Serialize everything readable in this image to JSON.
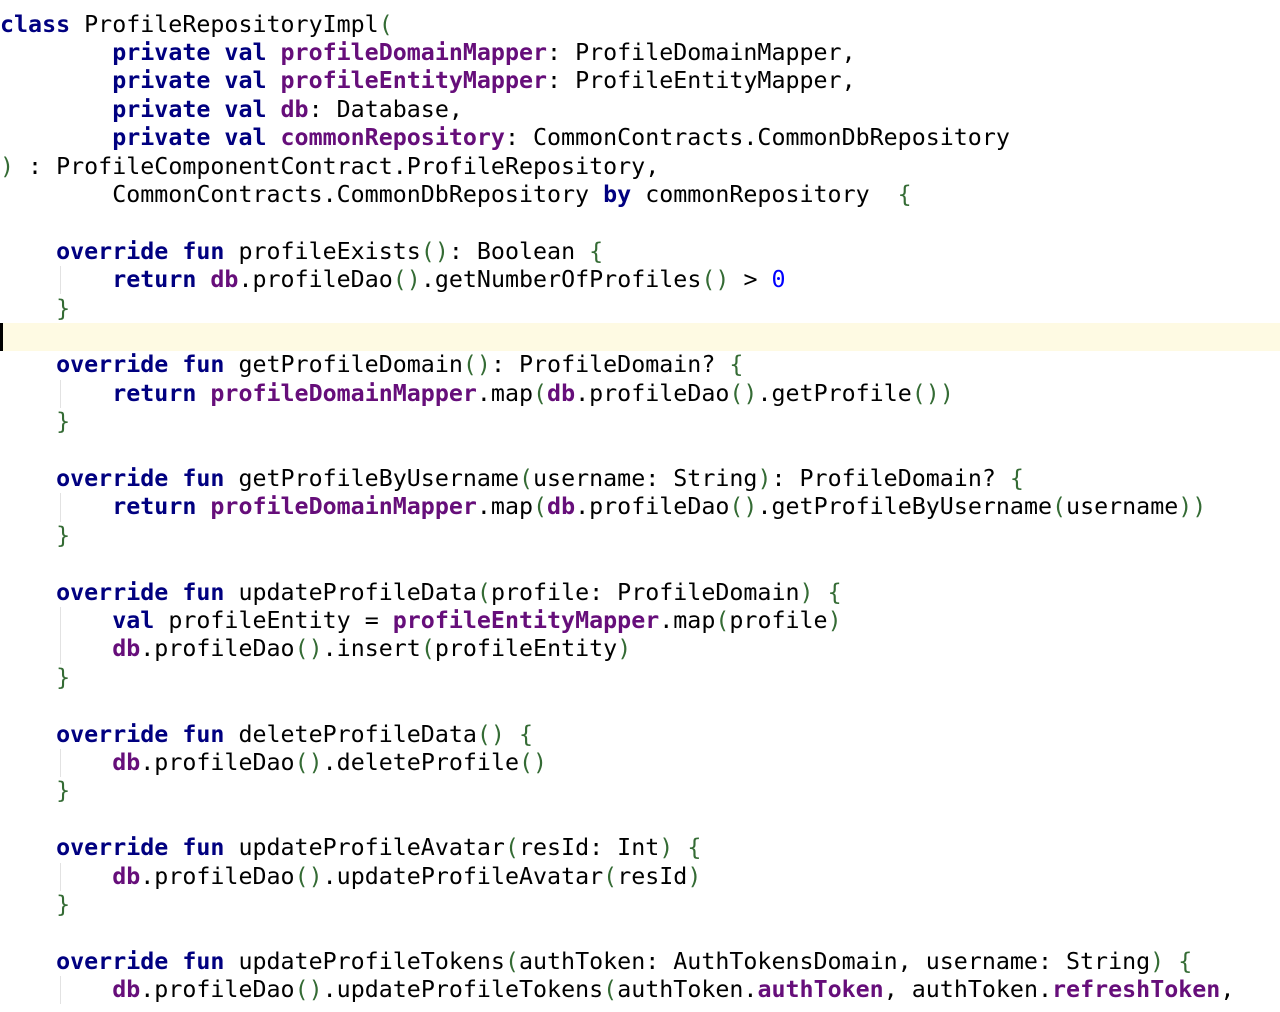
{
  "colors": {
    "keyword": "#000080",
    "field": "#660e7a",
    "number": "#0000ff",
    "bracket": "#346b34",
    "plain": "#000000",
    "current_line": "#fefae3"
  },
  "editor": {
    "current_line_index": 11,
    "lines": [
      [
        {
          "t": "class ",
          "c": "kw"
        },
        {
          "t": "ProfileRepositoryImpl"
        },
        {
          "t": "(",
          "c": "br"
        }
      ],
      [
        {
          "t": "        "
        },
        {
          "t": "private val ",
          "c": "kw"
        },
        {
          "t": "profileDomainMapper",
          "c": "fb"
        },
        {
          "t": ": ProfileDomainMapper,"
        }
      ],
      [
        {
          "t": "        "
        },
        {
          "t": "private val ",
          "c": "kw"
        },
        {
          "t": "profileEntityMapper",
          "c": "fb"
        },
        {
          "t": ": ProfileEntityMapper,"
        }
      ],
      [
        {
          "t": "        "
        },
        {
          "t": "private val ",
          "c": "kw"
        },
        {
          "t": "db",
          "c": "fb"
        },
        {
          "t": ": Database,"
        }
      ],
      [
        {
          "t": "        "
        },
        {
          "t": "private val ",
          "c": "kw"
        },
        {
          "t": "commonRepository",
          "c": "fb"
        },
        {
          "t": ": CommonContracts.CommonDbRepository"
        }
      ],
      [
        {
          "t": ")",
          "c": "br"
        },
        {
          "t": " : ProfileComponentContract.ProfileRepository,"
        }
      ],
      [
        {
          "t": "        CommonContracts.CommonDbRepository "
        },
        {
          "t": "by ",
          "c": "kw"
        },
        {
          "t": "commonRepository  "
        },
        {
          "t": "{",
          "c": "br"
        }
      ],
      [],
      [
        {
          "t": "    "
        },
        {
          "t": "override fun ",
          "c": "kw"
        },
        {
          "t": "profileExists"
        },
        {
          "t": "()",
          "c": "br"
        },
        {
          "t": ": Boolean "
        },
        {
          "t": "{",
          "c": "br"
        }
      ],
      [
        {
          "t": "        "
        },
        {
          "t": "return ",
          "c": "kw"
        },
        {
          "t": "db",
          "c": "fb"
        },
        {
          "t": ".profileDao"
        },
        {
          "t": "()",
          "c": "br"
        },
        {
          "t": ".getNumberOfProfiles"
        },
        {
          "t": "()",
          "c": "br"
        },
        {
          "t": " > "
        },
        {
          "t": "0",
          "c": "num"
        }
      ],
      [
        {
          "t": "    "
        },
        {
          "t": "}",
          "c": "br"
        }
      ],
      [],
      [
        {
          "t": "    "
        },
        {
          "t": "override fun ",
          "c": "kw"
        },
        {
          "t": "getProfileDomain"
        },
        {
          "t": "()",
          "c": "br"
        },
        {
          "t": ": ProfileDomain? "
        },
        {
          "t": "{",
          "c": "br"
        }
      ],
      [
        {
          "t": "        "
        },
        {
          "t": "return ",
          "c": "kw"
        },
        {
          "t": "profileDomainMapper",
          "c": "fb"
        },
        {
          "t": ".map"
        },
        {
          "t": "(",
          "c": "br"
        },
        {
          "t": "db",
          "c": "fb"
        },
        {
          "t": ".profileDao"
        },
        {
          "t": "()",
          "c": "br"
        },
        {
          "t": ".getProfile"
        },
        {
          "t": "())",
          "c": "br"
        }
      ],
      [
        {
          "t": "    "
        },
        {
          "t": "}",
          "c": "br"
        }
      ],
      [],
      [
        {
          "t": "    "
        },
        {
          "t": "override fun ",
          "c": "kw"
        },
        {
          "t": "getProfileByUsername"
        },
        {
          "t": "(",
          "c": "br"
        },
        {
          "t": "username: String"
        },
        {
          "t": ")",
          "c": "br"
        },
        {
          "t": ": ProfileDomain? "
        },
        {
          "t": "{",
          "c": "br"
        }
      ],
      [
        {
          "t": "        "
        },
        {
          "t": "return ",
          "c": "kw"
        },
        {
          "t": "profileDomainMapper",
          "c": "fb"
        },
        {
          "t": ".map"
        },
        {
          "t": "(",
          "c": "br"
        },
        {
          "t": "db",
          "c": "fb"
        },
        {
          "t": ".profileDao"
        },
        {
          "t": "()",
          "c": "br"
        },
        {
          "t": ".getProfileByUsername"
        },
        {
          "t": "(",
          "c": "br"
        },
        {
          "t": "username"
        },
        {
          "t": "))",
          "c": "br"
        }
      ],
      [
        {
          "t": "    "
        },
        {
          "t": "}",
          "c": "br"
        }
      ],
      [],
      [
        {
          "t": "    "
        },
        {
          "t": "override fun ",
          "c": "kw"
        },
        {
          "t": "updateProfileData"
        },
        {
          "t": "(",
          "c": "br"
        },
        {
          "t": "profile: ProfileDomain"
        },
        {
          "t": ")",
          "c": "br"
        },
        {
          "t": " "
        },
        {
          "t": "{",
          "c": "br"
        }
      ],
      [
        {
          "t": "        "
        },
        {
          "t": "val ",
          "c": "kw"
        },
        {
          "t": "profileEntity = "
        },
        {
          "t": "profileEntityMapper",
          "c": "fb"
        },
        {
          "t": ".map"
        },
        {
          "t": "(",
          "c": "br"
        },
        {
          "t": "profile"
        },
        {
          "t": ")",
          "c": "br"
        }
      ],
      [
        {
          "t": "        "
        },
        {
          "t": "db",
          "c": "fb"
        },
        {
          "t": ".profileDao"
        },
        {
          "t": "()",
          "c": "br"
        },
        {
          "t": ".insert"
        },
        {
          "t": "(",
          "c": "br"
        },
        {
          "t": "profileEntity"
        },
        {
          "t": ")",
          "c": "br"
        }
      ],
      [
        {
          "t": "    "
        },
        {
          "t": "}",
          "c": "br"
        }
      ],
      [],
      [
        {
          "t": "    "
        },
        {
          "t": "override fun ",
          "c": "kw"
        },
        {
          "t": "deleteProfileData"
        },
        {
          "t": "()",
          "c": "br"
        },
        {
          "t": " "
        },
        {
          "t": "{",
          "c": "br"
        }
      ],
      [
        {
          "t": "        "
        },
        {
          "t": "db",
          "c": "fb"
        },
        {
          "t": ".profileDao"
        },
        {
          "t": "()",
          "c": "br"
        },
        {
          "t": ".deleteProfile"
        },
        {
          "t": "()",
          "c": "br"
        }
      ],
      [
        {
          "t": "    "
        },
        {
          "t": "}",
          "c": "br"
        }
      ],
      [],
      [
        {
          "t": "    "
        },
        {
          "t": "override fun ",
          "c": "kw"
        },
        {
          "t": "updateProfileAvatar"
        },
        {
          "t": "(",
          "c": "br"
        },
        {
          "t": "resId: Int"
        },
        {
          "t": ")",
          "c": "br"
        },
        {
          "t": " "
        },
        {
          "t": "{",
          "c": "br"
        }
      ],
      [
        {
          "t": "        "
        },
        {
          "t": "db",
          "c": "fb"
        },
        {
          "t": ".profileDao"
        },
        {
          "t": "()",
          "c": "br"
        },
        {
          "t": ".updateProfileAvatar"
        },
        {
          "t": "(",
          "c": "br"
        },
        {
          "t": "resId"
        },
        {
          "t": ")",
          "c": "br"
        }
      ],
      [
        {
          "t": "    "
        },
        {
          "t": "}",
          "c": "br"
        }
      ],
      [],
      [
        {
          "t": "    "
        },
        {
          "t": "override fun ",
          "c": "kw"
        },
        {
          "t": "updateProfileTokens"
        },
        {
          "t": "(",
          "c": "br"
        },
        {
          "t": "authToken: AuthTokensDomain, username: String"
        },
        {
          "t": ")",
          "c": "br"
        },
        {
          "t": " "
        },
        {
          "t": "{",
          "c": "br"
        }
      ],
      [
        {
          "t": "        "
        },
        {
          "t": "db",
          "c": "fb"
        },
        {
          "t": ".profileDao"
        },
        {
          "t": "()",
          "c": "br"
        },
        {
          "t": ".updateProfileTokens"
        },
        {
          "t": "(",
          "c": "br"
        },
        {
          "t": "authToken."
        },
        {
          "t": "authToken",
          "c": "fb"
        },
        {
          "t": ", authToken."
        },
        {
          "t": "refreshToken",
          "c": "fb"
        },
        {
          "t": ","
        }
      ]
    ]
  }
}
